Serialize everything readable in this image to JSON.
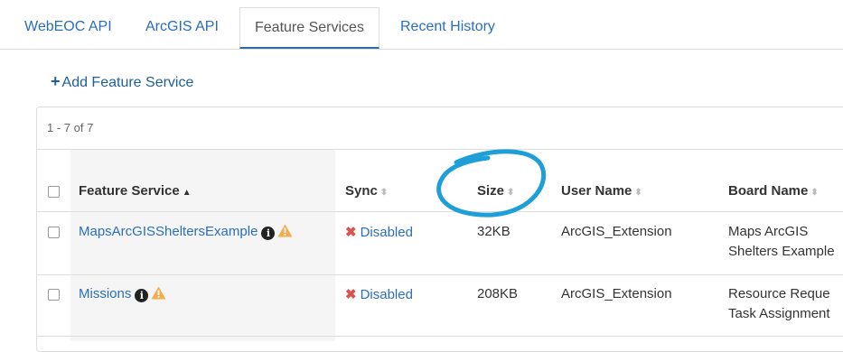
{
  "tabs": [
    {
      "label": "WebEOC API"
    },
    {
      "label": "ArcGIS API"
    },
    {
      "label": "Feature Services",
      "active": true
    },
    {
      "label": "Recent History"
    }
  ],
  "toolbar": {
    "add_label": "Add Feature Service"
  },
  "table": {
    "range_text": "1 - 7 of 7",
    "columns": [
      "Feature Service",
      "Sync",
      "Size",
      "User Name",
      "Board Name"
    ],
    "rows": [
      {
        "feature_service": "MapsArcGISSheltersExample",
        "sync": "Disabled",
        "size": "32KB",
        "user_name": "ArcGIS_Extension",
        "board_name_line1": "Maps ArcGIS",
        "board_name_line2": "Shelters Example"
      },
      {
        "feature_service": "Missions",
        "sync": "Disabled",
        "size": "208KB",
        "user_name": "ArcGIS_Extension",
        "board_name_line1": "Resource Reque",
        "board_name_line2": "Task Assignment"
      }
    ]
  },
  "colors": {
    "link": "#2a6ebb",
    "warning": "#f0ad4e",
    "disabled_x": "#d9534f",
    "annotation": "#1e9fd8"
  }
}
